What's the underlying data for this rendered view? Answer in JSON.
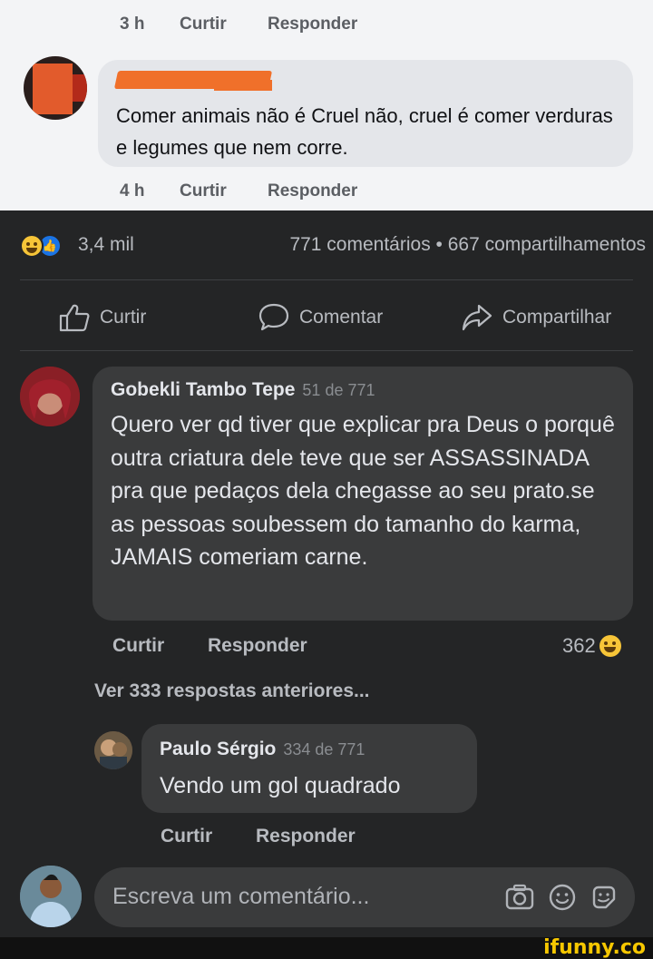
{
  "top_comment_meta": {
    "time": "3 h",
    "like": "Curtir",
    "reply": "Responder"
  },
  "light_comment": {
    "text": "Comer animais não é Cruel não, cruel é comer verduras e legumes que nem corre.",
    "meta": {
      "time": "4 h",
      "like": "Curtir",
      "reply": "Responder"
    }
  },
  "post_stats": {
    "reaction_count": "3,4 mil",
    "comments_shares": "771 comentários • 667 compartilhamentos",
    "reaction_icons": [
      "haha-icon",
      "like-icon"
    ]
  },
  "post_actions": {
    "like": "Curtir",
    "comment": "Comentar",
    "share": "Compartilhar"
  },
  "comment_1": {
    "author": "Gobekli Tambo Tepe",
    "position": "51 de 771",
    "text": "Quero ver qd tiver que explicar pra Deus o porquê outra criatura dele teve que ser ASSASSINADA pra que pedaços dela chegasse ao seu prato.se as pessoas soubessem do tamanho do karma, JAMAIS comeriam carne.",
    "like": "Curtir",
    "reply": "Responder",
    "reactions": "362"
  },
  "view_previous": "Ver 333 respostas anteriores...",
  "reply_1": {
    "author": "Paulo Sérgio",
    "position": "334 de 771",
    "text": "Vendo um gol quadrado",
    "like": "Curtir",
    "reply": "Responder"
  },
  "composer": {
    "placeholder": "Escreva um comentário..."
  },
  "watermark": "ifunny.co",
  "colors": {
    "dark_bg": "#242526",
    "bubble_dark": "#3a3b3c",
    "light_bg": "#f3f4f6",
    "bubble_light": "#e4e6ea",
    "redaction": "#f0702a",
    "like_blue": "#1b74e4",
    "haha_yellow": "#f7c538",
    "watermark": "#f6c700"
  }
}
